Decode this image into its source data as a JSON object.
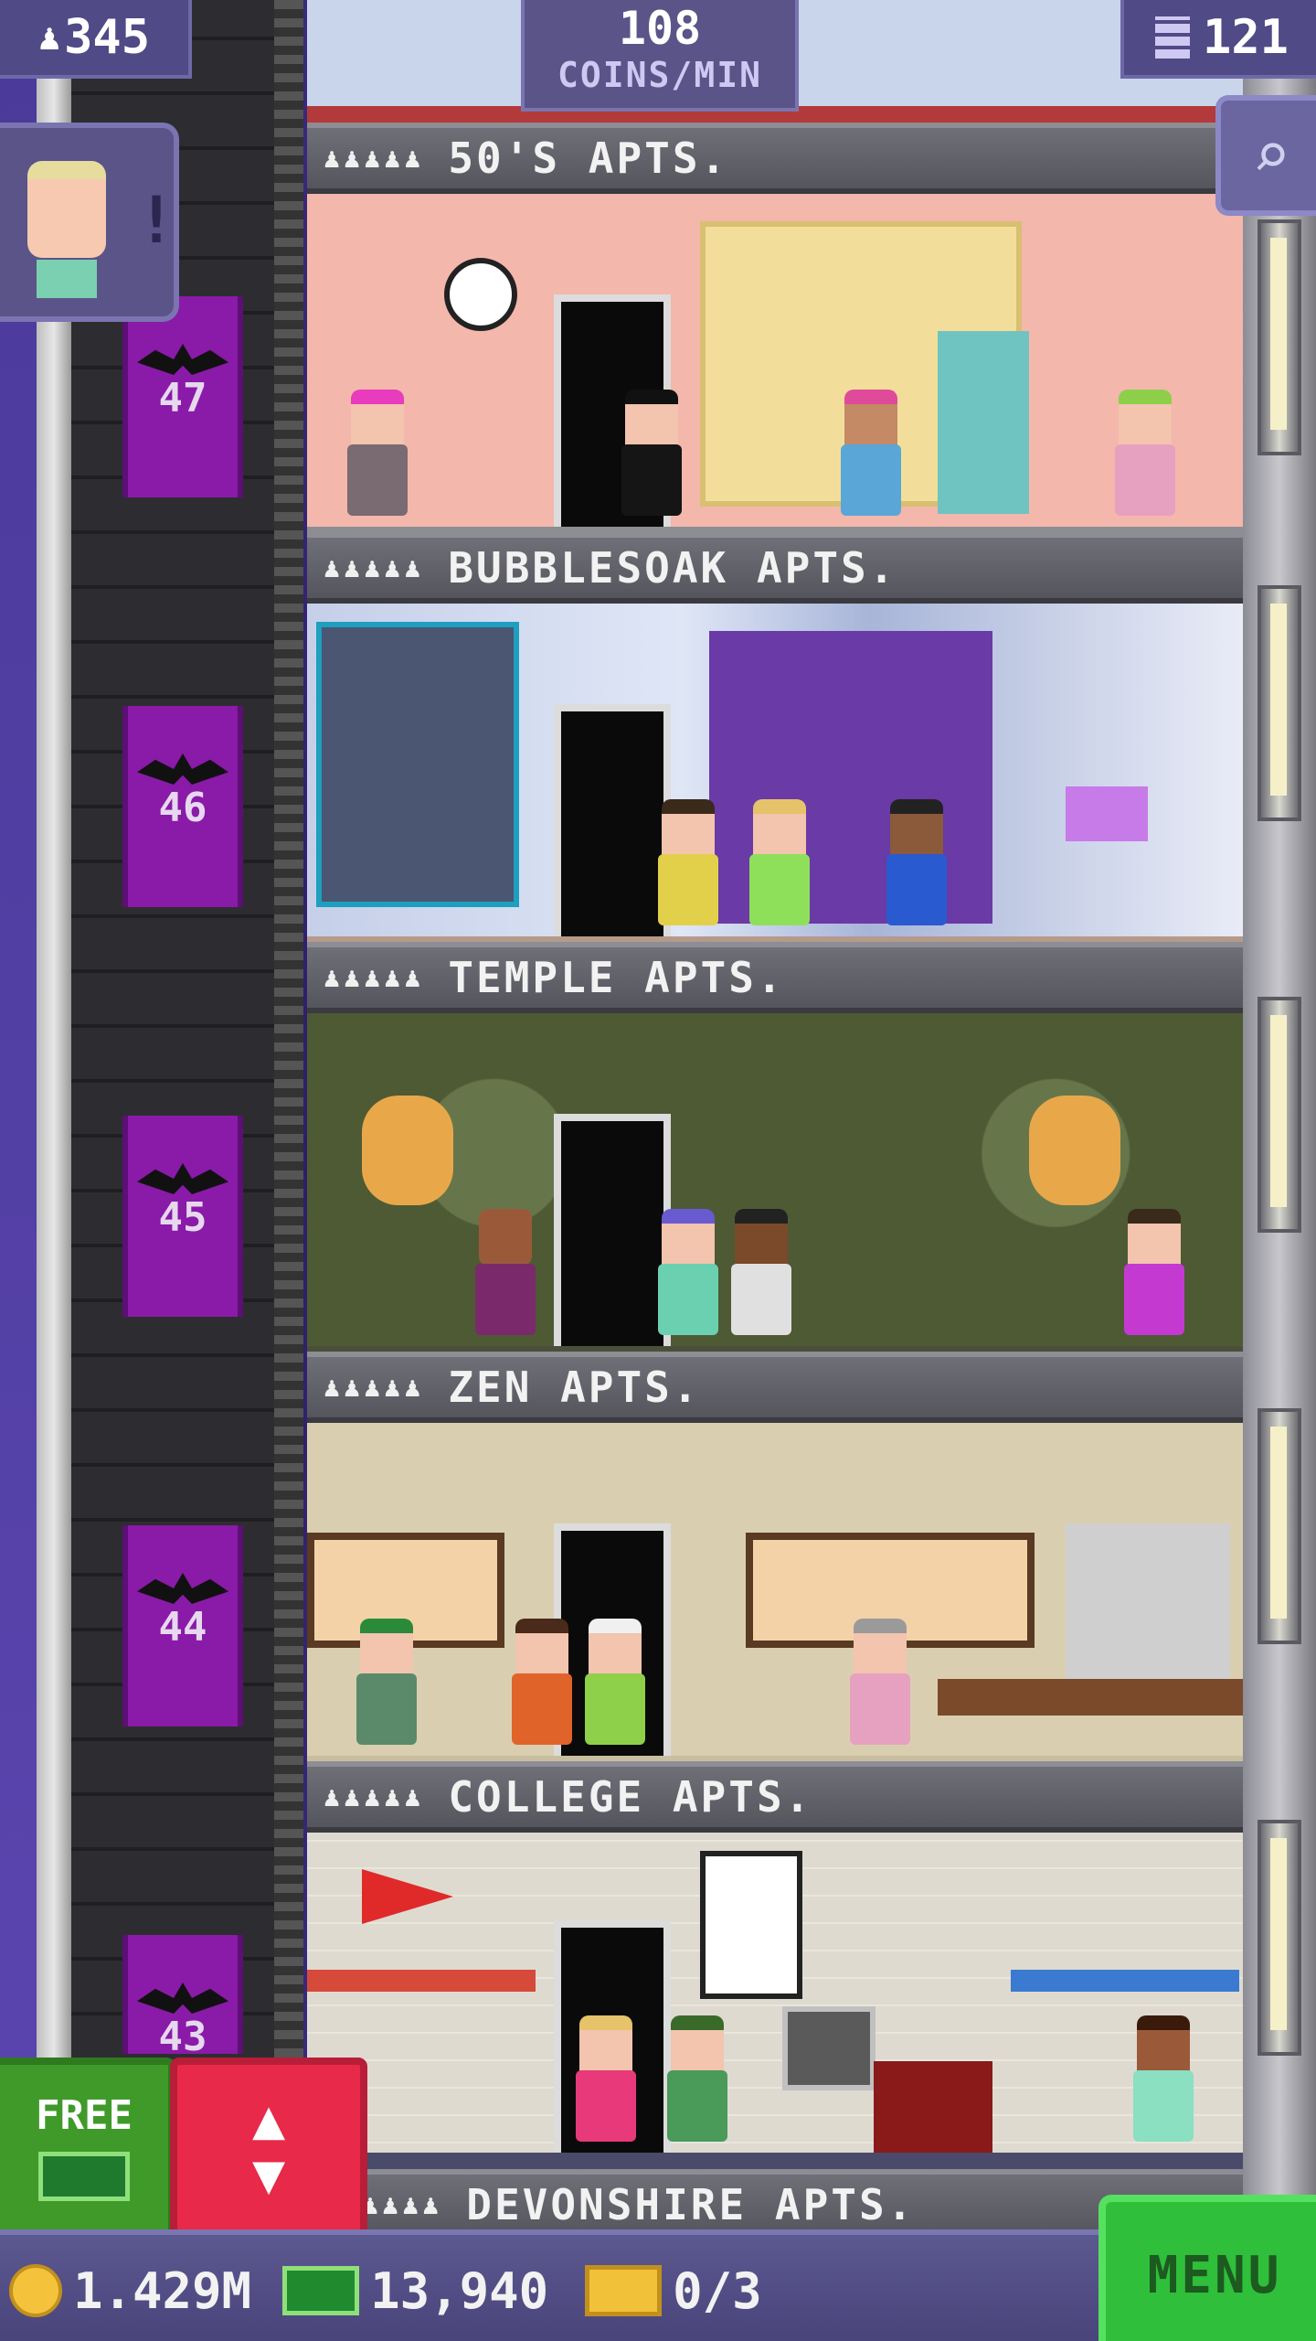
{
  "hud": {
    "population": "345",
    "coins_rate_value": "108",
    "coins_rate_unit": "COINS/MIN",
    "floor_count": "121"
  },
  "shaft_floors": [
    "47",
    "46",
    "45",
    "44",
    "43"
  ],
  "floors": [
    {
      "name": "50'S APTS.",
      "rating": "♟♟♟♟♟"
    },
    {
      "name": "BUBBLESOAK APTS.",
      "rating": "♟♟♟♟♟"
    },
    {
      "name": "TEMPLE APTS.",
      "rating": "♟♟♟♟♟"
    },
    {
      "name": "ZEN APTS.",
      "rating": "♟♟♟♟♟"
    },
    {
      "name": "COLLEGE APTS.",
      "rating": "♟♟♟♟♟"
    },
    {
      "name": "DEVONSHIRE APTS.",
      "rating": "♟♟♟♟"
    }
  ],
  "buttons": {
    "free_label": "FREE",
    "elevator_arrows": "▲\n▼",
    "menu_label": "MENU",
    "search_icon": "⌕"
  },
  "currency": {
    "coins": "1.429M",
    "bux": "13,940",
    "tickets": "0/3"
  },
  "colors": {
    "free_green": "#3f9a2a",
    "elevator_red": "#e8294a",
    "menu_green": "#2fbf3a",
    "shaft_purple": "#8a1aa8"
  }
}
